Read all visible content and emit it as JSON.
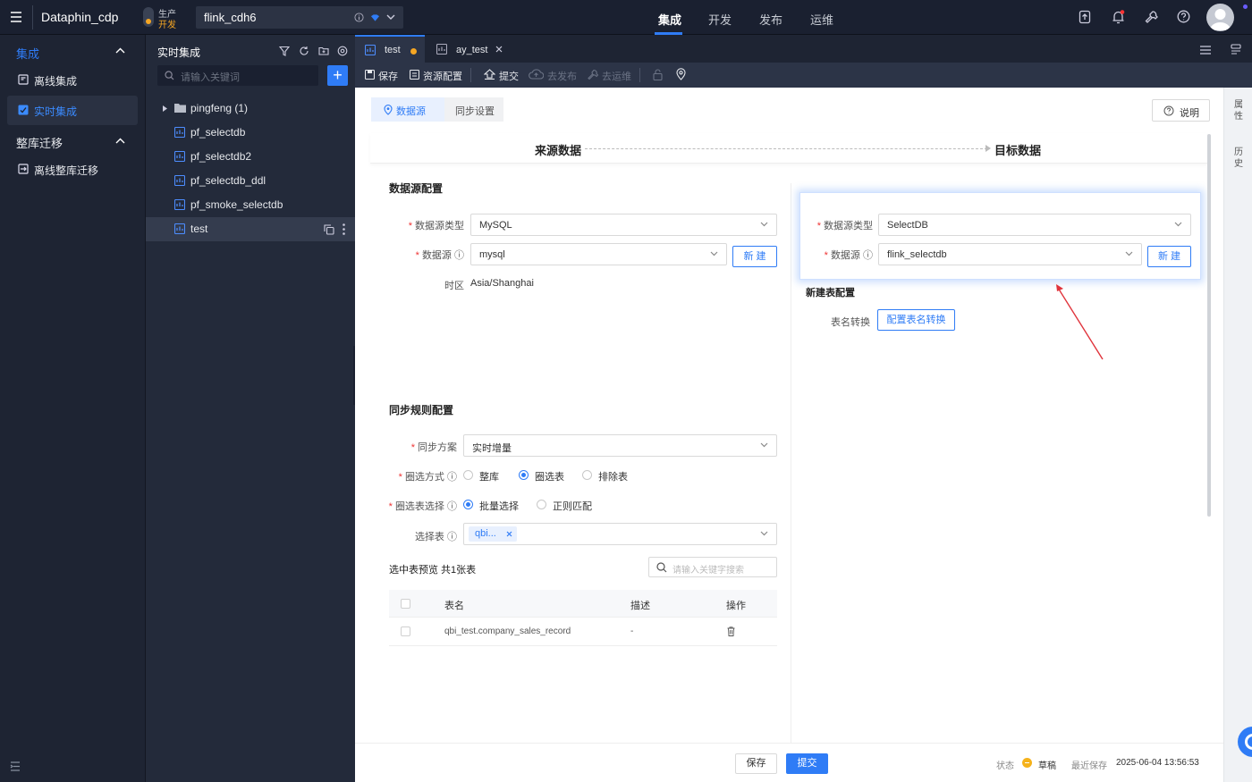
{
  "app": {
    "title": "Dataphin_cdp",
    "env_prod": "生产",
    "env_dev": "开发",
    "project": "flink_cdh6"
  },
  "topnav": [
    {
      "label": "集成",
      "active": true
    },
    {
      "label": "开发"
    },
    {
      "label": "发布"
    },
    {
      "label": "运维"
    }
  ],
  "leftnav": {
    "group1": "集成",
    "items1": [
      {
        "label": "离线集成"
      },
      {
        "label": "实时集成",
        "active": true
      }
    ],
    "group2": "整库迁移",
    "items2": [
      {
        "label": "离线整库迁移"
      }
    ]
  },
  "tree": {
    "title": "实时集成",
    "search_placeholder": "请输入关键词",
    "folder": "pingfeng (1)",
    "nodes": [
      "pf_selectdb",
      "pf_selectdb2",
      "pf_selectdb_ddl",
      "pf_smoke_selectdb",
      "test"
    ]
  },
  "tabs": [
    {
      "label": "test",
      "active": true
    },
    {
      "label": "ay_test"
    }
  ],
  "toolbar": {
    "save": "保存",
    "resource": "资源配置",
    "submit": "提交",
    "publish": "去发布",
    "ops": "去运维"
  },
  "steps": {
    "s1": "数据源",
    "s2": "同步设置"
  },
  "help": "说明",
  "right_tabs": {
    "attr1": "属",
    "attr2": "性",
    "hist1": "历",
    "hist2": "史"
  },
  "header": {
    "source": "来源数据",
    "target": "目标数据"
  },
  "source": {
    "title": "数据源配置",
    "type_label": "数据源类型",
    "type_value": "MySQL",
    "ds_label": "数据源",
    "ds_value": "mysql",
    "new_btn": "新 建",
    "tz_label": "时区",
    "tz_value": "Asia/Shanghai"
  },
  "target": {
    "type_label": "数据源类型",
    "type_value": "SelectDB",
    "ds_label": "数据源",
    "ds_value": "flink_selectdb",
    "new_btn": "新 建",
    "newtable_title": "新建表配置",
    "rename_label": "表名转换",
    "rename_btn": "配置表名转换"
  },
  "sync": {
    "title": "同步规则配置",
    "plan_label": "同步方案",
    "plan_value": "实时增量",
    "mode_label": "圈选方式",
    "mode_opts": [
      "整库",
      "圈选表",
      "排除表"
    ],
    "mode_selected": 1,
    "choose_label": "圈选表选择",
    "choose_opts": [
      "批量选择",
      "正则匹配"
    ],
    "choose_selected": 0,
    "table_label": "选择表",
    "table_tag": "qbi...",
    "preview": "选中表预览 共1张表",
    "search_placeholder": "请输入关键字搜索",
    "columns": [
      "表名",
      "描述",
      "操作"
    ],
    "rows": [
      {
        "name": "qbi_test.company_sales_record",
        "desc": "-"
      }
    ]
  },
  "footer": {
    "save": "保存",
    "submit": "提交",
    "status_label": "状态",
    "status_value": "草稿",
    "saved_label": "最近保存",
    "saved_time": "2025-06-04 13:56:53"
  },
  "colors": {
    "accent": "#2f7cf6",
    "arrow": "#e0333b",
    "draft": "#f5b21b"
  }
}
